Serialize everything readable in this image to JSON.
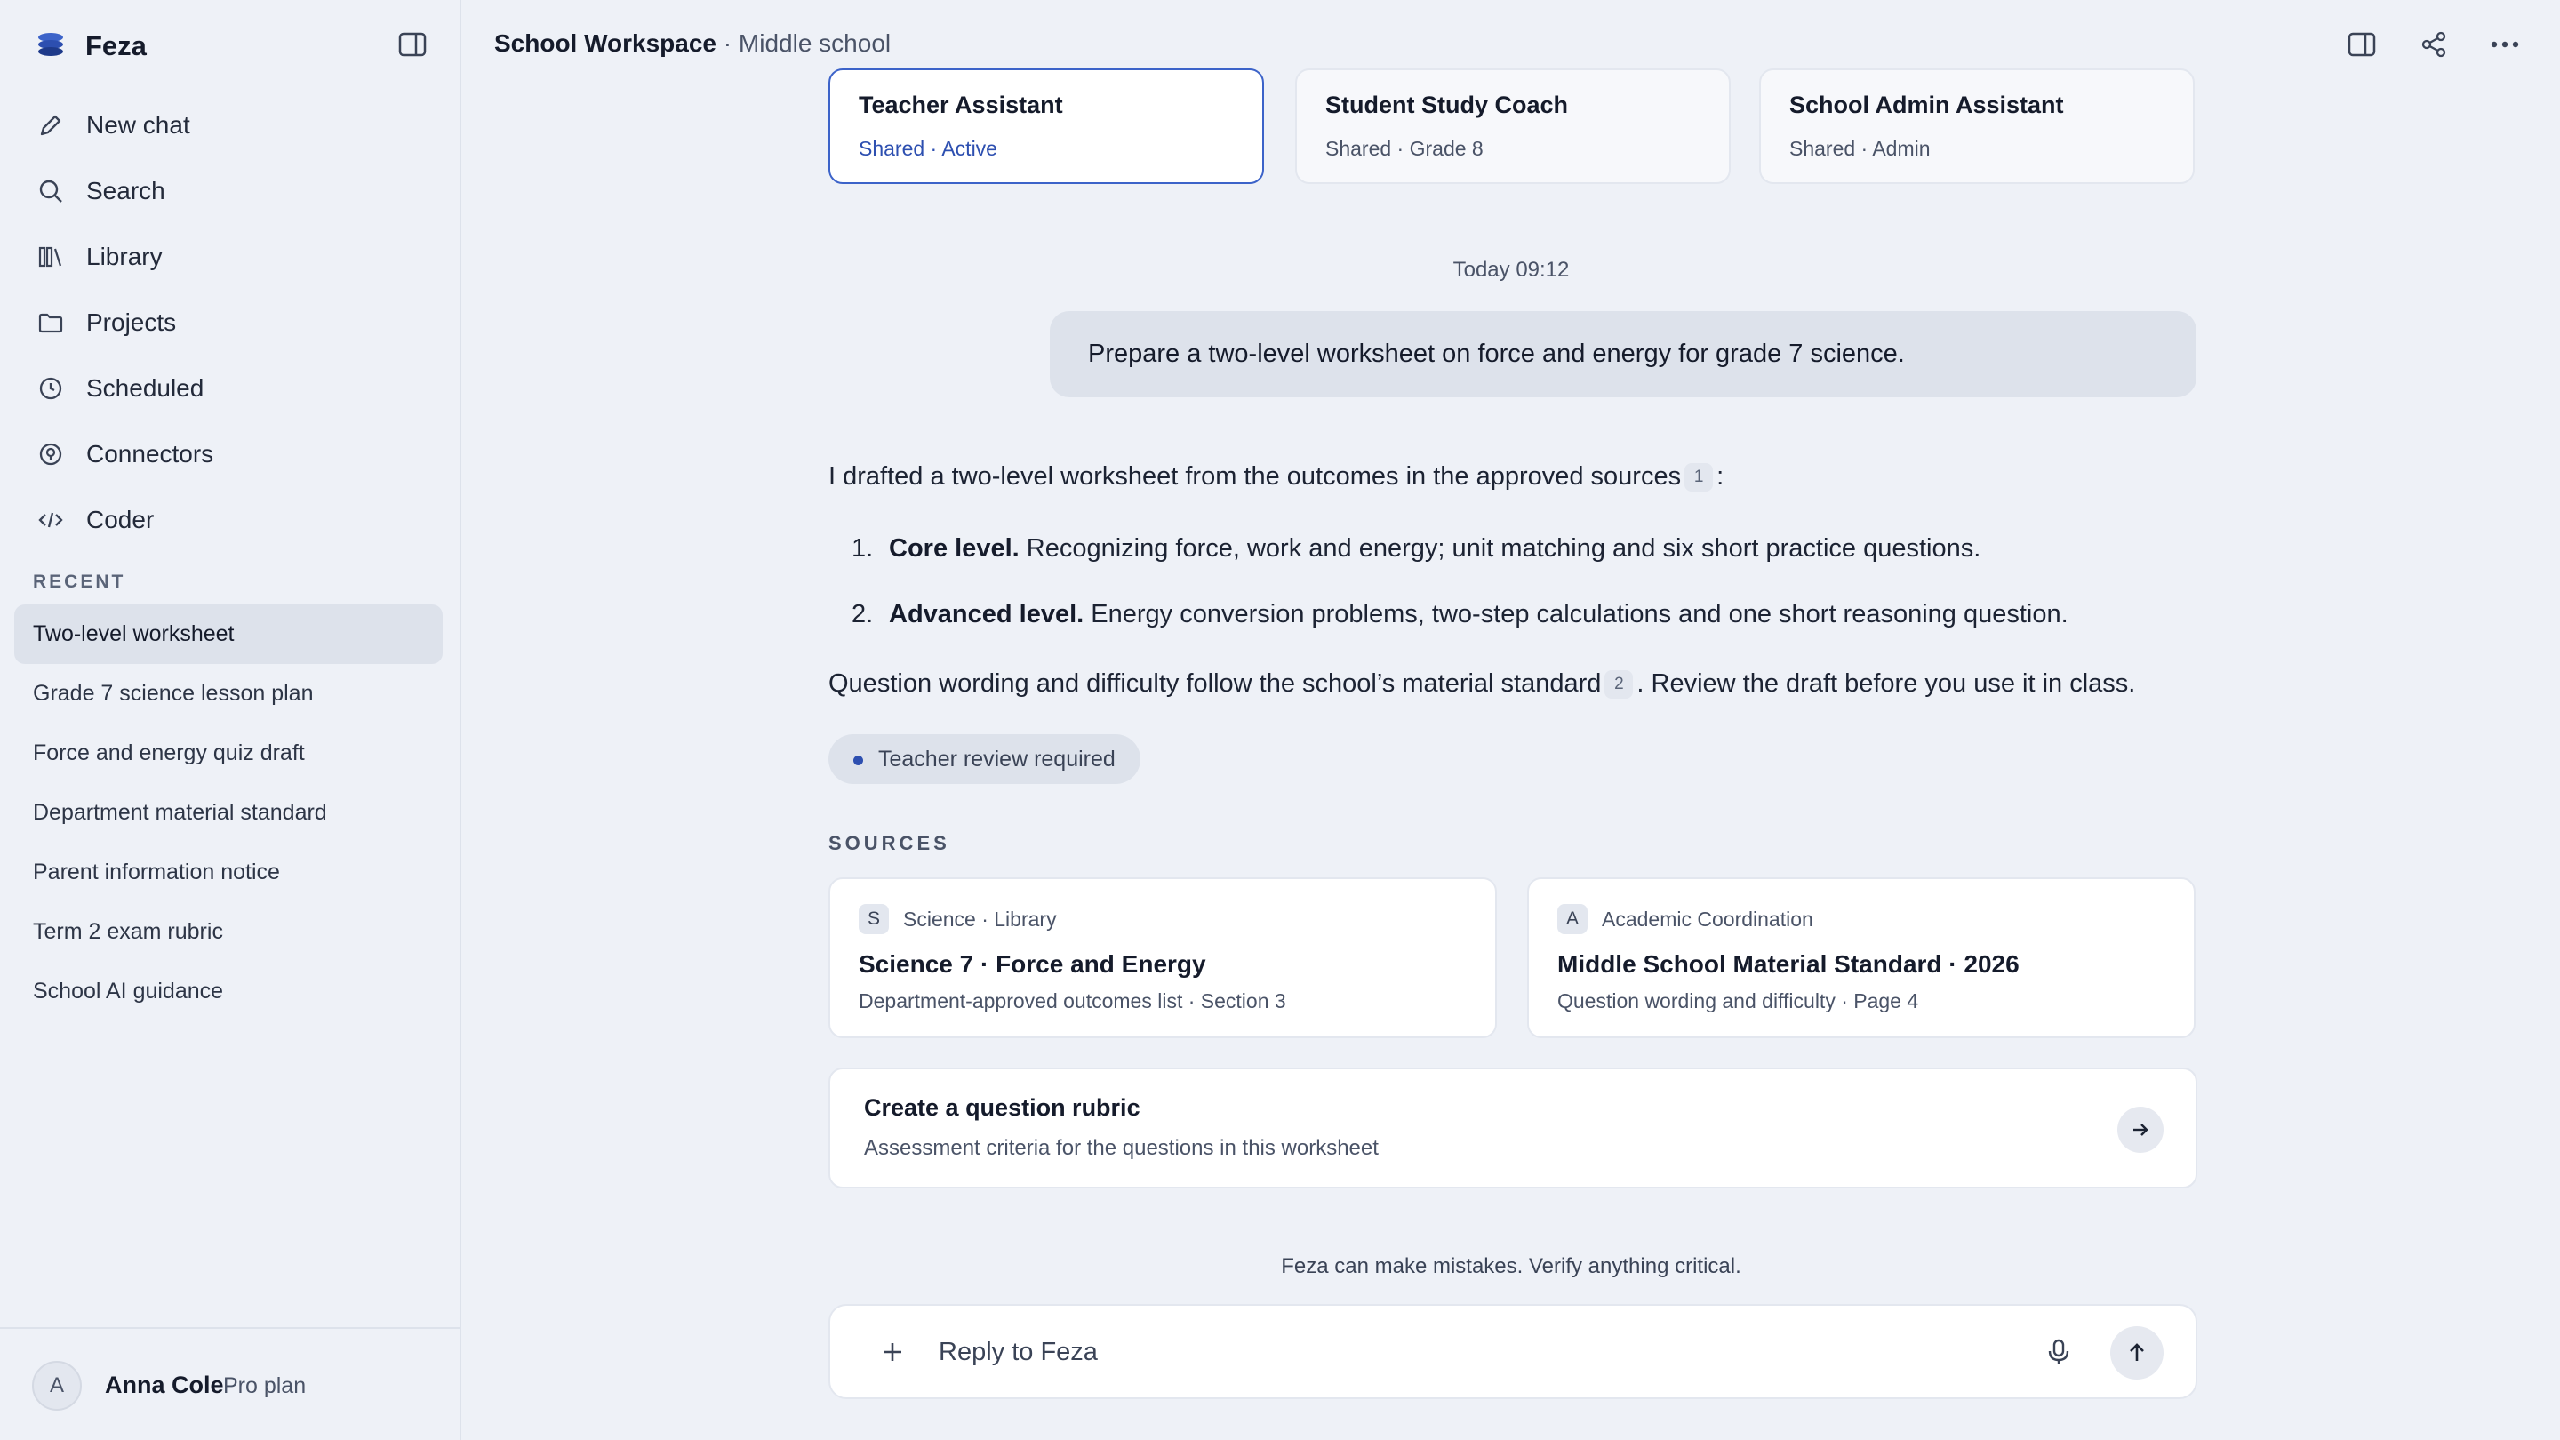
{
  "app": {
    "name": "Feza"
  },
  "sidebar": {
    "nav": [
      {
        "label": "New chat",
        "icon": "pencil-icon"
      },
      {
        "label": "Search",
        "icon": "search-icon"
      },
      {
        "label": "Library",
        "icon": "library-icon"
      },
      {
        "label": "Projects",
        "icon": "folder-icon"
      },
      {
        "label": "Scheduled",
        "icon": "clock-icon"
      },
      {
        "label": "Connectors",
        "icon": "plug-icon"
      },
      {
        "label": "Coder",
        "icon": "code-icon"
      }
    ],
    "recent_title": "RECENT",
    "recent": [
      "Two-level worksheet",
      "Grade 7 science lesson plan",
      "Force and energy quiz draft",
      "Department material standard",
      "Parent information notice",
      "Term 2 exam rubric",
      "School AI guidance"
    ],
    "active_recent": "Two-level worksheet",
    "user": {
      "initial": "A",
      "name": "Anna Cole",
      "plan": "Pro plan"
    }
  },
  "header": {
    "workspace": "School Workspace",
    "separator": " · ",
    "context": "Middle school"
  },
  "assistants": [
    {
      "name": "Teacher Assistant",
      "meta": "Shared · Active",
      "active": true
    },
    {
      "name": "Student Study Coach",
      "meta": "Shared · Grade 8",
      "active": false
    },
    {
      "name": "School Admin Assistant",
      "meta": "Shared · Admin",
      "active": false
    }
  ],
  "conversation": {
    "timestamp": "Today 09:12",
    "user_message": "Prepare a two-level worksheet on force and energy for grade 7 science.",
    "response": {
      "intro": "I drafted a two-level worksheet from the outcomes in the approved sources",
      "intro_cite": "1",
      "intro_end": ":",
      "items": [
        {
          "num": "1.",
          "title": "Core level.",
          "text": " Recognizing force, work and energy; unit matching and six short practice questions."
        },
        {
          "num": "2.",
          "title": "Advanced level.",
          "text": " Energy conversion problems, two-step calculations and one short reasoning question."
        }
      ],
      "outro": "Question wording and difficulty follow the school’s material standard",
      "outro_cite": "2",
      "outro_end": ". Review the draft before you use it in class.",
      "badge": "Teacher review required"
    },
    "sources_title": "SOURCES",
    "sources": [
      {
        "badge": "S",
        "origin": "Science · Library",
        "title": "Science 7 · Force and Energy",
        "sub": "Department-approved outcomes list · Section 3"
      },
      {
        "badge": "A",
        "origin": "Academic Coordination",
        "title": "Middle School Material Standard · 2026",
        "sub": "Question wording and difficulty · Page 4"
      }
    ],
    "action": {
      "title": "Create a question rubric",
      "sub": "Assessment criteria for the questions in this worksheet"
    }
  },
  "footer": {
    "disclaimer": "Feza can make mistakes. Verify anything critical.",
    "composer_placeholder": "Reply to Feza"
  },
  "colors": {
    "accent": "#2d4fb0",
    "background": "#eef1f7",
    "active_border": "#3c63c9"
  }
}
